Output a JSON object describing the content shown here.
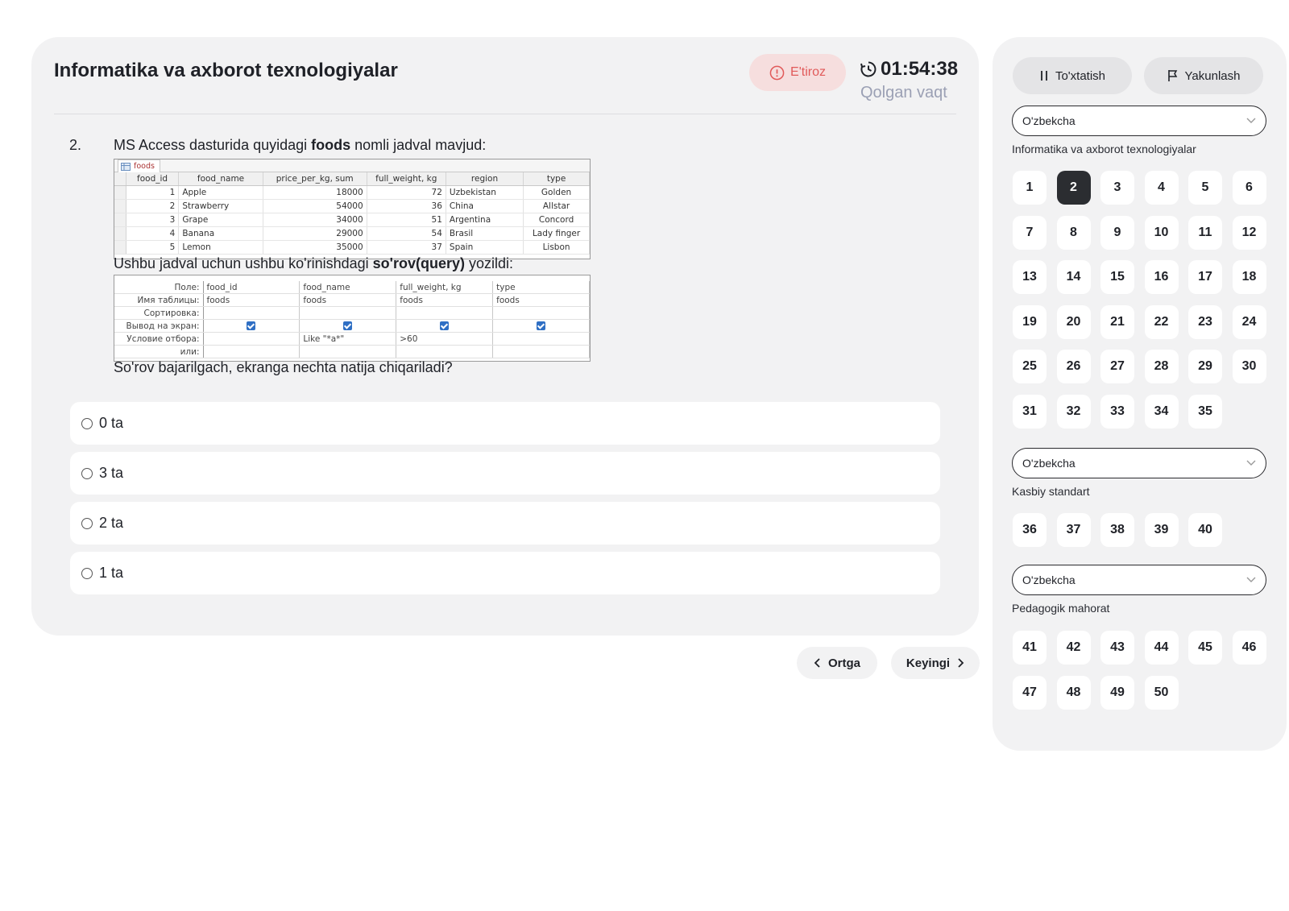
{
  "header": {
    "title": "Informatika va axborot texnologiyalar",
    "objection_label": "E'tiroz",
    "timer": "01:54:38",
    "timer_label": "Qolgan vaqt"
  },
  "question": {
    "number": "2.",
    "line1_a": "MS Access dasturida quyidagi ",
    "line1_b": "foods",
    "line1_c": " nomli jadval mavjud:",
    "line2_a": "Ushbu jadval uchun ushbu ko'rinishdagi ",
    "line2_b": "so'rov(query)",
    "line2_c": " yozildi:",
    "line3": "So'rov bajarilgach, ekranga nechta natija chiqariladi?",
    "table": {
      "tab_name": "foods",
      "headers": [
        "food_id",
        "food_name",
        "price_per_kg, sum",
        "full_weight, kg",
        "region",
        "type"
      ],
      "rows": [
        [
          "1",
          "Apple",
          "18000",
          "72",
          "Uzbekistan",
          "Golden"
        ],
        [
          "2",
          "Strawberry",
          "54000",
          "36",
          "China",
          "Allstar"
        ],
        [
          "3",
          "Grape",
          "34000",
          "51",
          "Argentina",
          "Concord"
        ],
        [
          "4",
          "Banana",
          "29000",
          "54",
          "Brasil",
          "Lady finger"
        ],
        [
          "5",
          "Lemon",
          "35000",
          "37",
          "Spain",
          "Lisbon"
        ]
      ]
    },
    "query": {
      "labels": [
        "Поле:",
        "Имя таблицы:",
        "Сортировка:",
        "Вывод на экран:",
        "Условие отбора:",
        "или:"
      ],
      "fields": [
        "food_id",
        "food_name",
        "full_weight, kg",
        "type"
      ],
      "tables": [
        "foods",
        "foods",
        "foods",
        "foods"
      ],
      "criteria": [
        "",
        "Like \"*a*\"",
        ">60",
        ""
      ]
    }
  },
  "options": [
    "0 ta",
    "3 ta",
    "2 ta",
    "1 ta"
  ],
  "nav": {
    "prev": "Ortga",
    "next": "Keyingi"
  },
  "sidebar": {
    "pause": "To'xtatish",
    "finish": "Yakunlash",
    "sections": [
      {
        "lang": "O'zbekcha",
        "title": "Informatika va axborot texnologiyalar",
        "questions": [
          "1",
          "2",
          "3",
          "4",
          "5",
          "6",
          "7",
          "8",
          "9",
          "10",
          "11",
          "12",
          "13",
          "14",
          "15",
          "16",
          "17",
          "18",
          "19",
          "20",
          "21",
          "22",
          "23",
          "24",
          "25",
          "26",
          "27",
          "28",
          "29",
          "30",
          "31",
          "32",
          "33",
          "34",
          "35"
        ]
      },
      {
        "lang": "O'zbekcha",
        "title": "Kasbiy standart",
        "questions": [
          "36",
          "37",
          "38",
          "39",
          "40"
        ]
      },
      {
        "lang": "O'zbekcha",
        "title": "Pedagogik mahorat",
        "questions": [
          "41",
          "42",
          "43",
          "44",
          "45",
          "46",
          "47",
          "48",
          "49",
          "50"
        ]
      }
    ],
    "active_question": "2"
  },
  "colors": {
    "accent_dark": "#2b2d31",
    "objection_bg": "#f6dede",
    "objection_text": "#e15a5a",
    "timer_label": "#9ba0b4"
  }
}
